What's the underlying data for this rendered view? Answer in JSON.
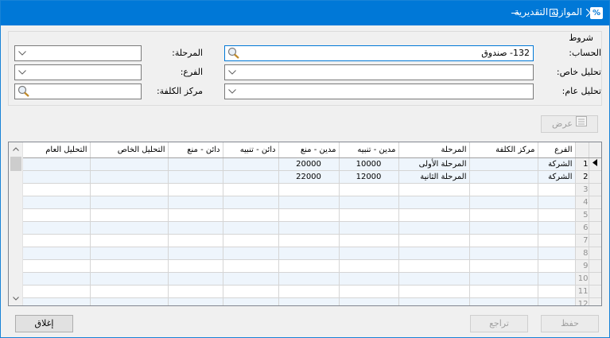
{
  "window": {
    "title": "الموازنة التقديرية",
    "icon_glyph": "%"
  },
  "criteria": {
    "legend": "شروط",
    "account_label": "الحساب:",
    "account_value": "132- صندوق",
    "special_analysis_label": "تحليل خاص:",
    "general_analysis_label": "تحليل عام:",
    "stage_label": "المرحلة:",
    "branch_label": "الفرع:",
    "cost_center_label": "مركز الكلفة:"
  },
  "toolbar": {
    "view_label": "عرض"
  },
  "grid": {
    "columns": [
      "الفرع",
      "مركز الكلفة",
      "المرحلة",
      "مدين - تنبيه",
      "مدين - منع",
      "دائن - تنبيه",
      "دائن - منع",
      "التحليل الخاص",
      "التحليل العام"
    ],
    "rows": [
      {
        "no": "1",
        "branch": "الشركة",
        "cost_center": "",
        "stage": "المرحلة الأولى",
        "debit_warn": "10000",
        "debit_block": "20000",
        "credit_warn": "",
        "credit_block": "",
        "special": "",
        "general": ""
      },
      {
        "no": "2",
        "branch": "الشركة",
        "cost_center": "",
        "stage": "المرحلة الثانية",
        "debit_warn": "12000",
        "debit_block": "22000",
        "credit_warn": "",
        "credit_block": "",
        "special": "",
        "general": ""
      }
    ],
    "empty_rows": [
      "3",
      "4",
      "5",
      "6",
      "7",
      "8",
      "9",
      "10",
      "11",
      "12"
    ]
  },
  "footer": {
    "close_label": "إغلاق",
    "undo_label": "تراجع",
    "save_label": "حفظ"
  },
  "colors": {
    "accent": "#0078d7"
  }
}
